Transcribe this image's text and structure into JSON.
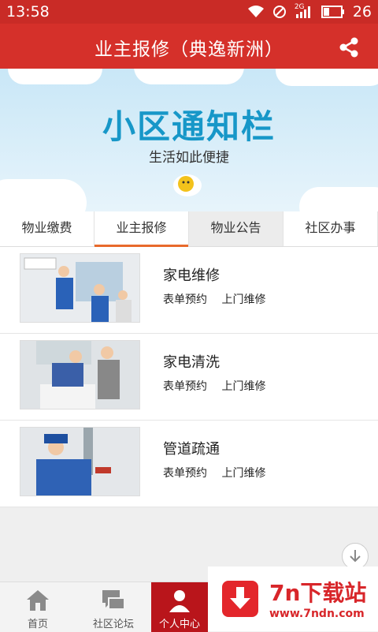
{
  "status": {
    "time": "13:58",
    "network": "2G",
    "battery": "26"
  },
  "appbar": {
    "title": "业主报修（典逸新洲）"
  },
  "banner": {
    "headline": "小区通知栏",
    "subtitle": "生活如此便捷"
  },
  "tabs": [
    {
      "label": "物业缴费"
    },
    {
      "label": "业主报修"
    },
    {
      "label": "物业公告"
    },
    {
      "label": "社区办事"
    }
  ],
  "services": [
    {
      "name": "家电维修",
      "tag1": "表单预约",
      "tag2": "上门维修"
    },
    {
      "name": "家电清洗",
      "tag1": "表单预约",
      "tag2": "上门维修"
    },
    {
      "name": "管道疏通",
      "tag1": "表单预约",
      "tag2": "上门维修"
    }
  ],
  "nav": [
    {
      "label": "首页",
      "icon": "home-icon"
    },
    {
      "label": "社区论坛",
      "icon": "chat-icon"
    },
    {
      "label": "个人中心",
      "icon": "person-icon"
    }
  ],
  "watermark": {
    "title": "7n下载站",
    "url": "www.7ndn.com"
  },
  "colors": {
    "primary": "#d5302a",
    "statusbar": "#c92b26",
    "accent": "#e86a2c",
    "nav_active": "#b9151b",
    "banner_text": "#1797c8"
  }
}
